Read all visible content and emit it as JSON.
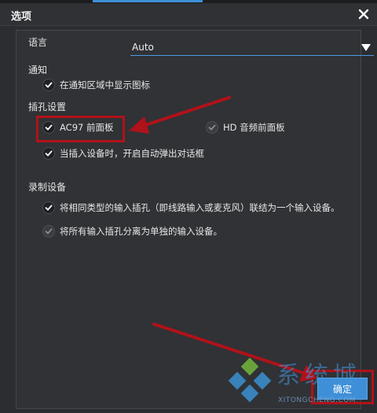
{
  "window": {
    "title": "选项"
  },
  "language": {
    "label": "语言",
    "value": "Auto"
  },
  "notification": {
    "section": "通知",
    "show_icon": {
      "label": "在通知区域中显示图标",
      "checked": true
    }
  },
  "jack_settings": {
    "section": "插孔设置",
    "ac97": {
      "label": "AC97 前面板",
      "checked": true
    },
    "hd_audio": {
      "label": "HD 音频前面板",
      "checked": false
    },
    "auto_popup": {
      "label": "当插入设备时，开启自动弹出对话框",
      "checked": true
    }
  },
  "recording": {
    "section": "录制设备",
    "combine": {
      "label": "将相同类型的输入插孔（即线路输入或麦克风）联结为一个输入设备。",
      "checked": true
    },
    "separate": {
      "label": "将所有输入插孔分离为单独的输入设备。",
      "checked": false
    }
  },
  "buttons": {
    "ok_label": "确定"
  },
  "watermark": {
    "chars": "系统城",
    "url": "XITONGCHENG.COM"
  },
  "colors": {
    "accent": "#3f8fd8",
    "highlight": "#b0121a",
    "background": "#2b2d30"
  }
}
